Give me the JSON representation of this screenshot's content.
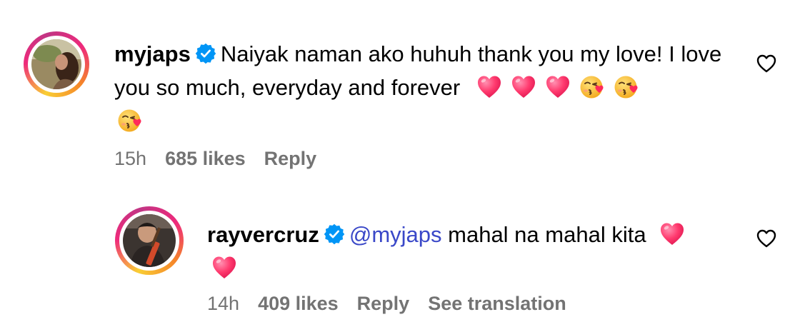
{
  "comments": [
    {
      "username": "myjaps",
      "verified": true,
      "text": "Naiyak naman ako huhuh thank you my love! I love you so much, everyday and forever",
      "emojis": [
        "heart-emoji",
        "heart-emoji",
        "heart-emoji",
        "kissing-face-emoji",
        "kissing-face-emoji",
        "kissing-face-emoji"
      ],
      "time": "15h",
      "likes": "685 likes",
      "reply_label": "Reply"
    },
    {
      "username": "rayvercruz",
      "verified": true,
      "mention": "@myjaps",
      "text": "mahal na mahal kita",
      "emojis": [
        "heart-emoji",
        "heart-emoji"
      ],
      "time": "14h",
      "likes": "409 likes",
      "reply_label": "Reply",
      "translate_label": "See translation"
    }
  ],
  "icons": {
    "like": "heart-outline-icon",
    "verified": "verified-badge-icon"
  },
  "colors": {
    "accent": "#0095f6",
    "mention": "#3a48c8",
    "meta": "#737373",
    "heart": "#ff3a6e"
  }
}
